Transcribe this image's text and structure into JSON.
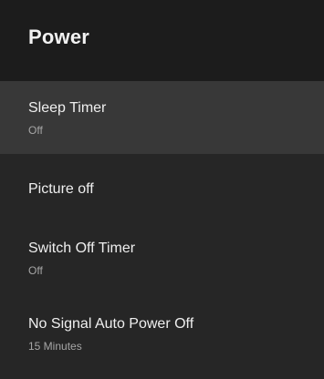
{
  "header": {
    "title": "Power"
  },
  "menu": {
    "items": [
      {
        "label": "Sleep Timer",
        "value": "Off",
        "selected": true
      },
      {
        "label": "Picture off",
        "value": ""
      },
      {
        "label": "Switch Off Timer",
        "value": "Off"
      },
      {
        "label": "No Signal Auto Power Off",
        "value": "15 Minutes"
      }
    ]
  },
  "colors": {
    "background": "#262626",
    "header_background": "#1c1c1c",
    "selected_background": "#383838",
    "primary_text": "#efefef",
    "secondary_text": "#a6a6a6"
  }
}
